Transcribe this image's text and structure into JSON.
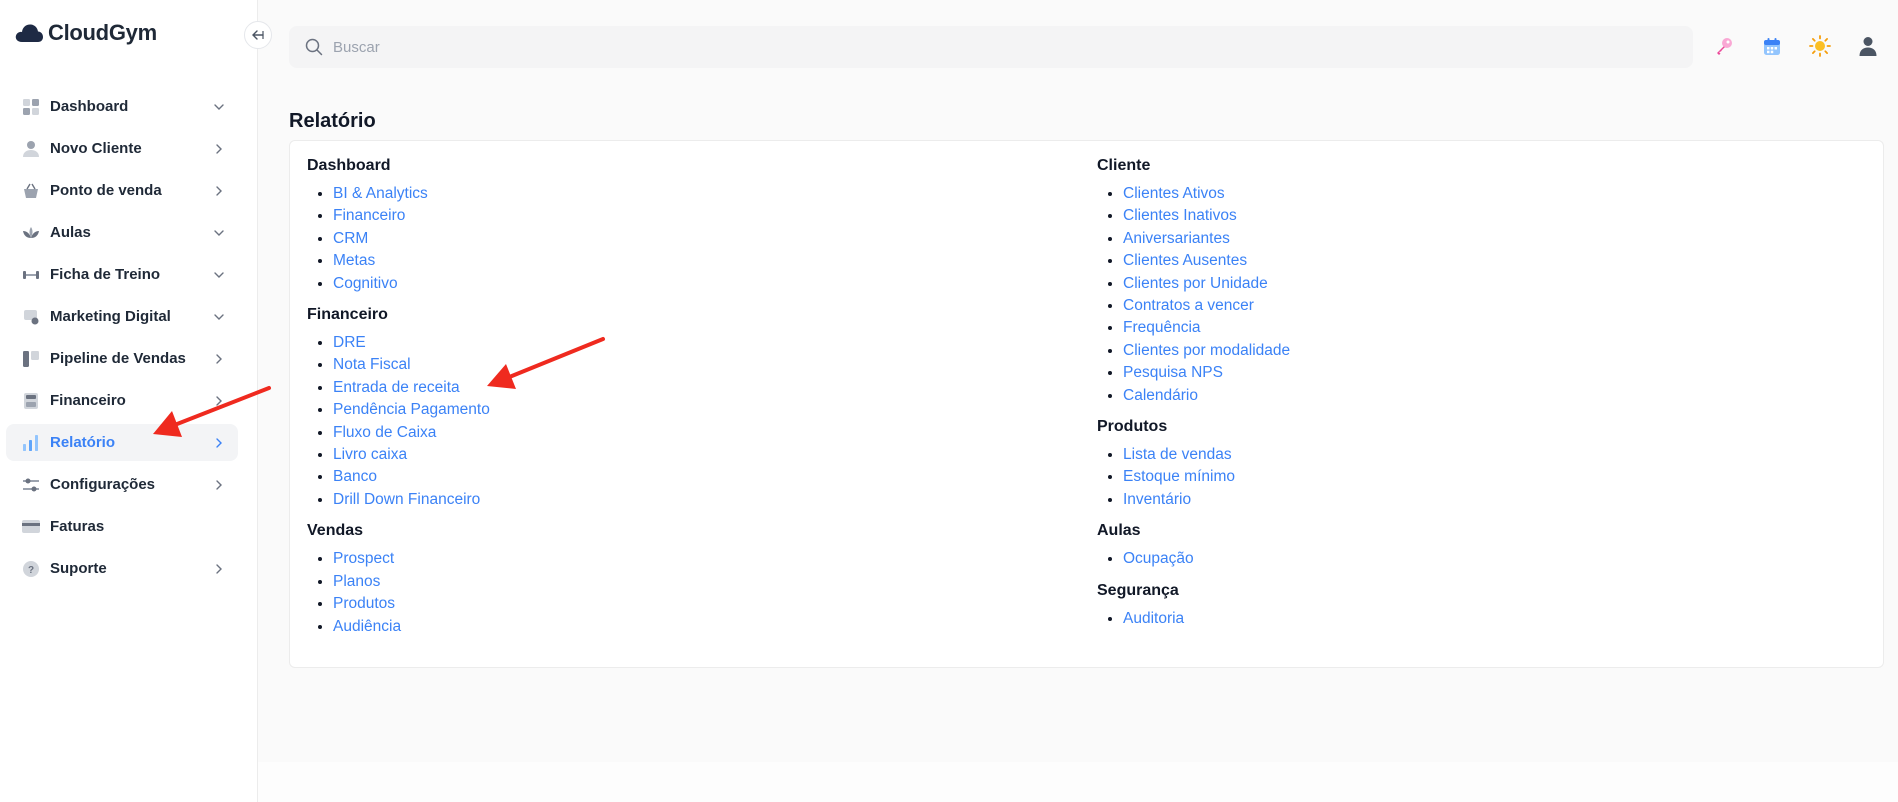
{
  "brand": {
    "name": "CloudGym"
  },
  "search": {
    "placeholder": "Buscar"
  },
  "sidebar": {
    "items": [
      {
        "label": "Dashboard",
        "icon": "grid-icon",
        "chevron": "down"
      },
      {
        "label": "Novo Cliente",
        "icon": "user-icon",
        "chevron": "right"
      },
      {
        "label": "Ponto de venda",
        "icon": "basket-icon",
        "chevron": "right"
      },
      {
        "label": "Aulas",
        "icon": "lotus-icon",
        "chevron": "down"
      },
      {
        "label": "Ficha de Treino",
        "icon": "dumbbell-icon",
        "chevron": "down"
      },
      {
        "label": "Marketing Digital",
        "icon": "megaphone-icon",
        "chevron": "down"
      },
      {
        "label": "Pipeline de Vendas",
        "icon": "pipeline-icon",
        "chevron": "right"
      },
      {
        "label": "Financeiro",
        "icon": "calculator-icon",
        "chevron": "right"
      },
      {
        "label": "Relatório",
        "icon": "bar-chart-icon",
        "chevron": "right",
        "active": true
      },
      {
        "label": "Configurações",
        "icon": "sliders-icon",
        "chevron": "right"
      },
      {
        "label": "Faturas",
        "icon": "credit-card-icon",
        "chevron": "none"
      },
      {
        "label": "Suporte",
        "icon": "help-icon",
        "chevron": "right"
      }
    ]
  },
  "page": {
    "title": "Relatório"
  },
  "report": {
    "left": [
      {
        "title": "Dashboard",
        "links": [
          "BI & Analytics",
          "Financeiro",
          "CRM",
          "Metas",
          "Cognitivo"
        ]
      },
      {
        "title": "Financeiro",
        "links": [
          "DRE",
          "Nota Fiscal",
          "Entrada de receita",
          "Pendência Pagamento",
          "Fluxo de Caixa",
          "Livro caixa",
          "Banco",
          "Drill Down Financeiro"
        ]
      },
      {
        "title": "Vendas",
        "links": [
          "Prospect",
          "Planos",
          "Produtos",
          "Audiência"
        ]
      }
    ],
    "right": [
      {
        "title": "Cliente",
        "links": [
          "Clientes Ativos",
          "Clientes Inativos",
          "Aniversariantes",
          "Clientes Ausentes",
          "Clientes por Unidade",
          "Contratos a vencer",
          "Frequência",
          "Clientes por modalidade",
          "Pesquisa NPS",
          "Calendário"
        ]
      },
      {
        "title": "Produtos",
        "links": [
          "Lista de vendas",
          "Estoque mínimo",
          "Inventário"
        ]
      },
      {
        "title": "Aulas",
        "links": [
          "Ocupação"
        ]
      },
      {
        "title": "Segurança",
        "links": [
          "Auditoria"
        ]
      }
    ]
  },
  "colors": {
    "accent": "#3b82f6",
    "annotation_arrow": "#ef2a1f"
  }
}
